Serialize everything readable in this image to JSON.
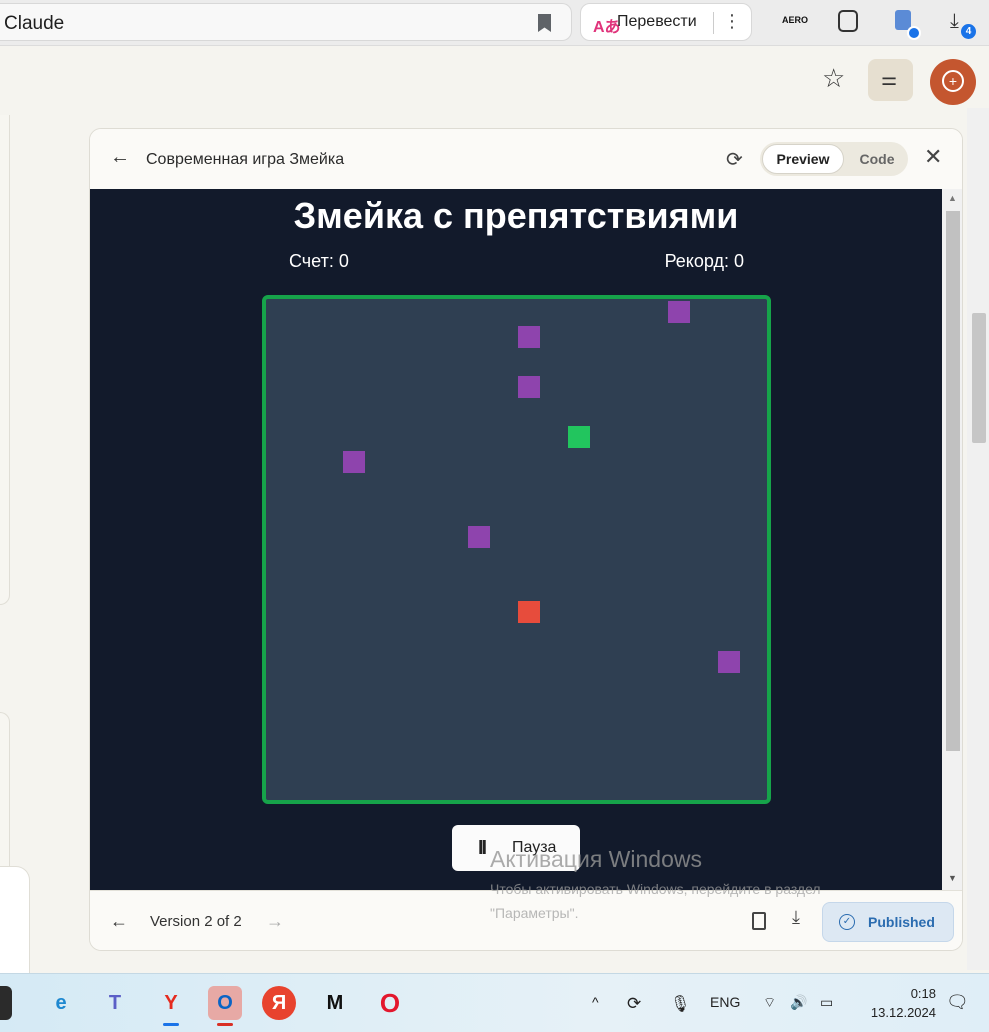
{
  "browser": {
    "address_text": "Claude",
    "translate_label": "Перевести",
    "translate_icon": "Aあ",
    "more_glyph": "⋮",
    "ext_aero": "AERO",
    "download_badge": "4"
  },
  "claude_header": {
    "star_glyph": "☆",
    "settings_glyph": "⚌",
    "avatar_glyph": "+"
  },
  "artifact": {
    "back_glyph": "←",
    "title": "Современная игра Змейка",
    "refresh_glyph": "⟳",
    "tabs": {
      "preview": "Preview",
      "code": "Code",
      "active": "preview"
    },
    "close_glyph": "✕"
  },
  "game": {
    "title": "Змейка с препятствиями",
    "score_text": "Счет: 0",
    "record_text": "Рекорд: 0",
    "grid_size": 20,
    "board_color": "#2f3f52",
    "border_color": "#16a34a",
    "background_color": "#121a2b",
    "obstacle_color": "#8e44ad",
    "food_color": "#e74c3c",
    "snake_color": "#22c55e",
    "snake": [
      [
        12,
        10
      ]
    ],
    "food": [
      [
        5,
        12
      ]
    ],
    "obstacles": [
      [
        0,
        16
      ],
      [
        1,
        10
      ],
      [
        3,
        10
      ],
      [
        6,
        3
      ],
      [
        9,
        8
      ],
      [
        14,
        18
      ]
    ],
    "pause_glyph": "II",
    "pause_label": "Пауза"
  },
  "footer": {
    "prev_glyph": "←",
    "version_label": "Version 2 of 2",
    "next_glyph": "→",
    "download_glyph": "⤓",
    "published_label": "Published",
    "published_check": "✓"
  },
  "watermark": {
    "title": "Активация Windows",
    "line1": "Чтобы активировать Windows, перейдите в раздел",
    "line2": "\"Параметры\"."
  },
  "taskbar": {
    "apps": [
      {
        "name": "edge",
        "glyph": "e",
        "color": "#1e88d0"
      },
      {
        "name": "teams",
        "glyph": "T",
        "color": "#5b5fc7"
      },
      {
        "name": "yandex-browser",
        "glyph": "Y",
        "color": "#e52b1f"
      },
      {
        "name": "outlook",
        "glyph": "O",
        "color": "#0a64c5"
      },
      {
        "name": "yandex",
        "glyph": "Я",
        "color": "#ffffff"
      },
      {
        "name": "miro",
        "glyph": "M",
        "color": "#111111"
      },
      {
        "name": "opera",
        "glyph": "O",
        "color": "#e3172d"
      }
    ],
    "tray_chevron": "^",
    "lang": "ENG",
    "time": "0:18",
    "date": "13.12.2024"
  }
}
